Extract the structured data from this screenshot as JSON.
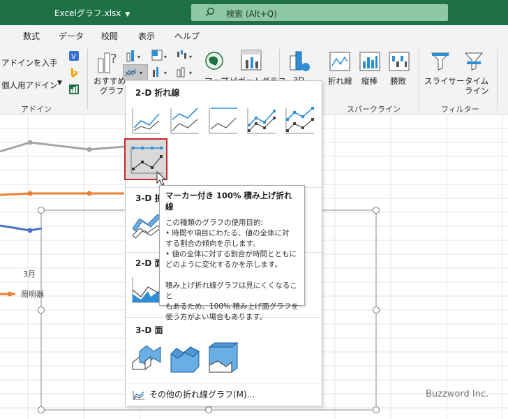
{
  "titlebar": {
    "filename": "Excelグラフ.xlsx",
    "search_text": "検索 (Alt+Q)"
  },
  "tabs": [
    "数式",
    "データ",
    "校閲",
    "表示",
    "ヘルプ"
  ],
  "ribbon": {
    "addins": {
      "get_label": "アドインを入手",
      "personal_label": "個人用アドイン",
      "group_label": "アドイン"
    },
    "recommended": {
      "label_line1": "おすすめ",
      "label_line2": "グラフ"
    },
    "maps_label": "マップ",
    "pivot_label": "ピボットグラフ",
    "threed_label": "3D",
    "sparklines": {
      "line": "折れ線",
      "column": "縦棒",
      "winloss": "勝敗",
      "group_label": "スパークライン"
    },
    "filters": {
      "slicer": "スライサー",
      "timeline_1": "タイム",
      "timeline_2": "ライン",
      "group_label": "フィルター"
    }
  },
  "sheet": {
    "axis_label": "3月",
    "legend_label": "照明器"
  },
  "dropdown": {
    "section_2d_line": "2-D 折れ線",
    "section_3d_line": "3-D 折",
    "section_2d_area": "2-D 面",
    "section_3d_area": "3-D 面",
    "more_link": "その他の折れ線グラフ(M)..."
  },
  "tooltip": {
    "title": "マーカー付き 100% 積み上げ折れ線",
    "lines": [
      "この種類のグラフの使用目的:",
      "• 時間や項目にわたる、値の全体に対",
      "  する割合の傾向を示します。",
      "• 値の全体に対する割合が時間とともに",
      "  どのように変化するかを示します。",
      "",
      "積み上げ折れ線グラフは見にくくなること",
      "もあるため、100% 積み上げ面グラフを",
      "使う方がよい場合もあります。"
    ]
  },
  "watermark": "Buzzword Inc.",
  "colors": {
    "title_bar": "#1e7145",
    "search_box": "#8fc8a4",
    "accent_blue": "#2f8fd6",
    "selection_red": "#c8262b"
  }
}
